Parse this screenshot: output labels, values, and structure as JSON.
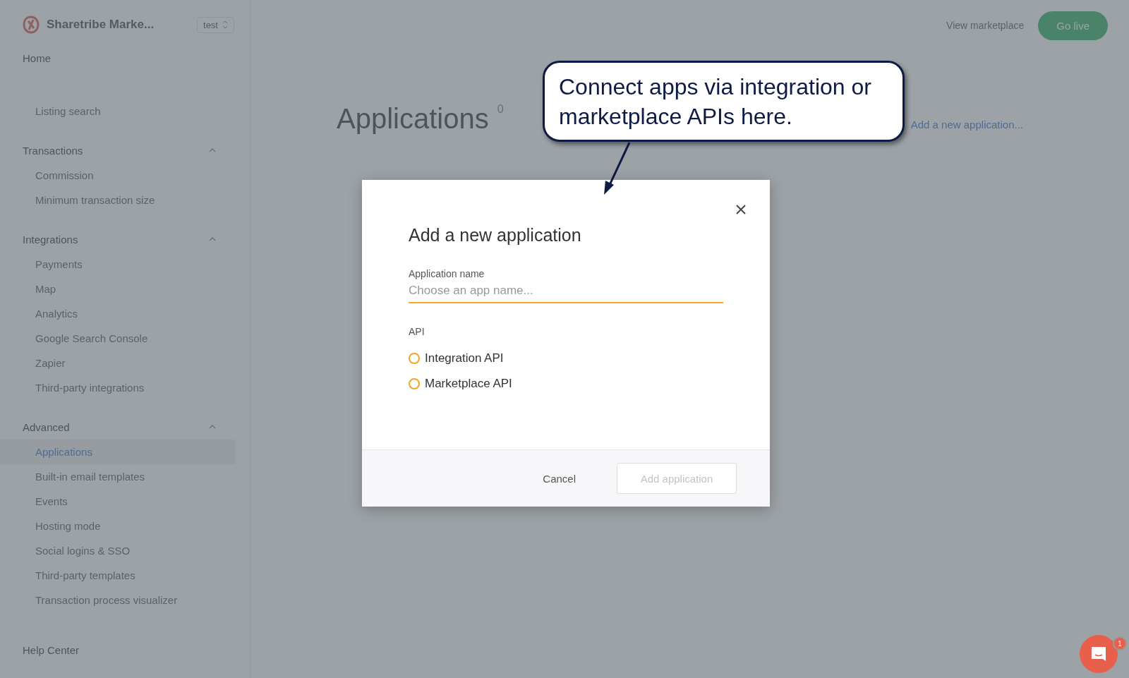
{
  "sidebar": {
    "brand": "Sharetribe Marke...",
    "env_badge": "test",
    "nav": [
      {
        "kind": "top",
        "label": "Home",
        "selected": false
      },
      {
        "kind": "link",
        "label": "Listing search",
        "selected": false
      },
      {
        "kind": "group",
        "label": "Transactions",
        "expanded": true,
        "children": [
          {
            "label": "Commission",
            "selected": false
          },
          {
            "label": "Minimum transaction size",
            "selected": false
          }
        ]
      },
      {
        "kind": "group",
        "label": "Integrations",
        "expanded": true,
        "children": [
          {
            "label": "Payments",
            "selected": false
          },
          {
            "label": "Map",
            "selected": false
          },
          {
            "label": "Analytics",
            "selected": false
          },
          {
            "label": "Google Search Console",
            "selected": false
          },
          {
            "label": "Zapier",
            "selected": false
          },
          {
            "label": "Third-party integrations",
            "selected": false
          }
        ]
      },
      {
        "kind": "group",
        "label": "Advanced",
        "expanded": true,
        "children": [
          {
            "label": "Applications",
            "selected": true
          },
          {
            "label": "Built-in email templates",
            "selected": false
          },
          {
            "label": "Events",
            "selected": false
          },
          {
            "label": "Hosting mode",
            "selected": false
          },
          {
            "label": "Social logins & SSO",
            "selected": false
          },
          {
            "label": "Third-party templates",
            "selected": false
          },
          {
            "label": "Transaction process visualizer",
            "selected": false
          }
        ]
      }
    ],
    "help": "Help Center"
  },
  "header": {
    "view_link": "View marketplace",
    "go_live": "Go live"
  },
  "main": {
    "title": "Applications",
    "count": "0",
    "add_link": "Add a new application..."
  },
  "modal": {
    "title": "Add a new application",
    "field_label": "Application name",
    "placeholder": "Choose an app name...",
    "api_label": "API",
    "options": [
      {
        "label": "Integration API",
        "selected": false
      },
      {
        "label": "Marketplace API",
        "selected": false
      }
    ],
    "cancel": "Cancel",
    "submit": "Add application",
    "submit_disabled": true
  },
  "callout": {
    "text": "Connect apps via integration or marketplace APIs here."
  },
  "chat": {
    "badge": "1"
  }
}
